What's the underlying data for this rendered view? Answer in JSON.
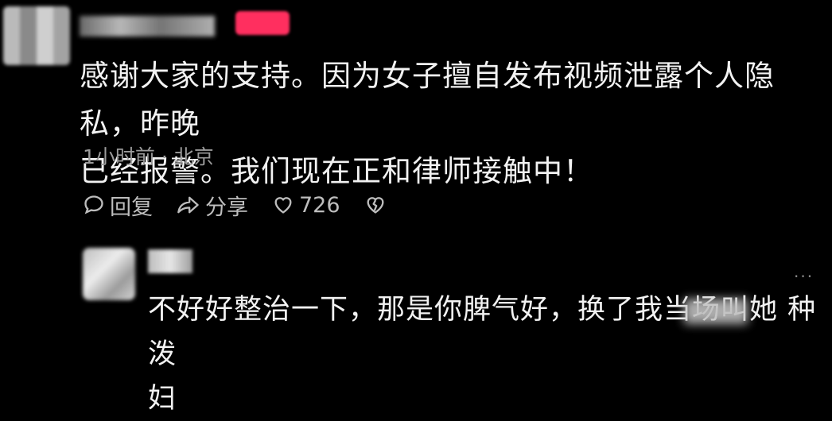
{
  "comment": {
    "text_line1": "感谢大家的支持。因为女子擅自发布视频泄露个人隐私，昨晚",
    "text_line2": "已经报警。我们现在正和律师接触中！",
    "meta": "1小时前 · 北京"
  },
  "actions": {
    "reply_label": "回复",
    "share_label": "分享",
    "like_count": "726"
  },
  "reply": {
    "more": "···",
    "text_line1": "不好好整治一下，那是你脾气好，换了我当场叫她   种泼",
    "text_line2": "妇"
  },
  "icons": {
    "reply": "comment-bubble-icon",
    "share": "share-arrow-icon",
    "like": "heart-icon",
    "dislike": "broken-heart-icon"
  },
  "colors": {
    "background": "#000000",
    "text": "#f2f2f2",
    "meta": "#9b9b9b",
    "badge": "#ff2f5f"
  }
}
